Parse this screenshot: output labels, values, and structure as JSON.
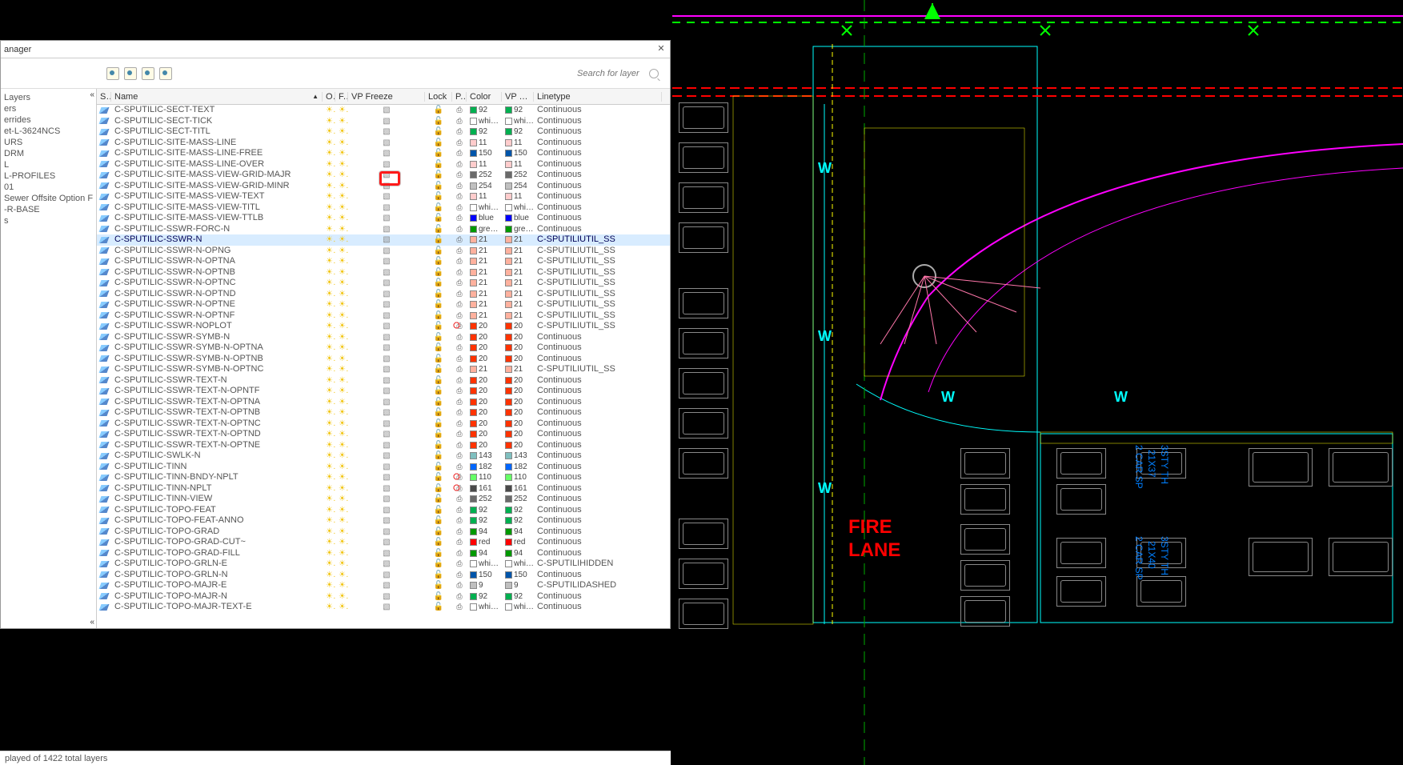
{
  "panel": {
    "title_fragment": "anager",
    "search_placeholder": "Search for layer"
  },
  "status": {
    "text": "played of 1422 total layers"
  },
  "cad": {
    "fire_lane": "FIRE\nLANE",
    "w_labels": [
      "W",
      "W",
      "W",
      "W",
      "W"
    ],
    "side1a": "3STY TH",
    "side1b": "21X37",
    "side1c": "2 CAR SP",
    "side2a": "3STY TH",
    "side2b": "21X40",
    "side2c": "2 CAR SP"
  },
  "sidebar_items": [
    "",
    "",
    "Layers",
    "ers",
    "errides",
    "",
    "et-L-3624NCS",
    "",
    "URS",
    "DRM",
    "L",
    "L-PROFILES",
    "01",
    "Sewer Offsite Option F",
    "-R-BASE",
    "s"
  ],
  "columns": {
    "s": "S..",
    "name": "Name",
    "o": "O..",
    "f": "F..",
    "vpf": "VP Freeze",
    "lock": "Lock",
    "p": "P..",
    "color": "Color",
    "vpc": "VP C..",
    "lt": "Linetype"
  },
  "palette": {
    "92": "#00b050",
    "whi": "#ffffff",
    "11": "#ffcccc",
    "150": "#0055aa",
    "252": "#6a6a6a",
    "254": "#c0c0c0",
    "blue": "#0000ff",
    "gre": "#009900",
    "21": "#ffb19e",
    "20": "#ff3300",
    "143": "#7fbfbf",
    "182": "#0066ff",
    "110": "#66ff66",
    "161": "#4a4a4a",
    "94": "#009900",
    "red": "#ff0000",
    "9": "#bfbfbf"
  },
  "layers": [
    {
      "name": "C-SPUTILIC-SECT-TEXT",
      "color": "92",
      "lt": "Continuous"
    },
    {
      "name": "C-SPUTILIC-SECT-TICK",
      "color": "whi",
      "lt": "Continuous"
    },
    {
      "name": "C-SPUTILIC-SECT-TITL",
      "color": "92",
      "lt": "Continuous"
    },
    {
      "name": "C-SPUTILIC-SITE-MASS-LINE",
      "color": "11",
      "lt": "Continuous"
    },
    {
      "name": "C-SPUTILIC-SITE-MASS-LINE-FREE",
      "color": "150",
      "lt": "Continuous"
    },
    {
      "name": "C-SPUTILIC-SITE-MASS-LINE-OVER",
      "color": "11",
      "lt": "Continuous"
    },
    {
      "name": "C-SPUTILIC-SITE-MASS-VIEW-GRID-MAJR",
      "color": "252",
      "lt": "Continuous"
    },
    {
      "name": "C-SPUTILIC-SITE-MASS-VIEW-GRID-MINR",
      "color": "254",
      "lt": "Continuous"
    },
    {
      "name": "C-SPUTILIC-SITE-MASS-VIEW-TEXT",
      "color": "11",
      "lt": "Continuous"
    },
    {
      "name": "C-SPUTILIC-SITE-MASS-VIEW-TITL",
      "color": "whi",
      "lt": "Continuous"
    },
    {
      "name": "C-SPUTILIC-SITE-MASS-VIEW-TTLB",
      "color": "blue",
      "lt": "Continuous"
    },
    {
      "name": "C-SPUTILIC-SSWR-FORC-N",
      "color": "gre",
      "lt": "Continuous"
    },
    {
      "name": "C-SPUTILIC-SSWR-N",
      "color": "21",
      "lt": "C-SPUTILIUTIL_SS",
      "sel": true
    },
    {
      "name": "C-SPUTILIC-SSWR-N-OPNG",
      "color": "21",
      "lt": "C-SPUTILIUTIL_SS"
    },
    {
      "name": "C-SPUTILIC-SSWR-N-OPTNA",
      "color": "21",
      "lt": "C-SPUTILIUTIL_SS"
    },
    {
      "name": "C-SPUTILIC-SSWR-N-OPTNB",
      "color": "21",
      "lt": "C-SPUTILIUTIL_SS"
    },
    {
      "name": "C-SPUTILIC-SSWR-N-OPTNC",
      "color": "21",
      "lt": "C-SPUTILIUTIL_SS"
    },
    {
      "name": "C-SPUTILIC-SSWR-N-OPTND",
      "color": "21",
      "lt": "C-SPUTILIUTIL_SS"
    },
    {
      "name": "C-SPUTILIC-SSWR-N-OPTNE",
      "color": "21",
      "lt": "C-SPUTILIUTIL_SS"
    },
    {
      "name": "C-SPUTILIC-SSWR-N-OPTNF",
      "color": "21",
      "lt": "C-SPUTILIUTIL_SS"
    },
    {
      "name": "C-SPUTILIC-SSWR-NOPLOT",
      "color": "20",
      "lt": "C-SPUTILIUTIL_SS",
      "noplot": true
    },
    {
      "name": "C-SPUTILIC-SSWR-SYMB-N",
      "color": "20",
      "lt": "Continuous"
    },
    {
      "name": "C-SPUTILIC-SSWR-SYMB-N-OPTNA",
      "color": "20",
      "lt": "Continuous"
    },
    {
      "name": "C-SPUTILIC-SSWR-SYMB-N-OPTNB",
      "color": "20",
      "lt": "Continuous"
    },
    {
      "name": "C-SPUTILIC-SSWR-SYMB-N-OPTNC",
      "color": "21",
      "lt": "C-SPUTILIUTIL_SS"
    },
    {
      "name": "C-SPUTILIC-SSWR-TEXT-N",
      "color": "20",
      "lt": "Continuous"
    },
    {
      "name": "C-SPUTILIC-SSWR-TEXT-N-OPNTF",
      "color": "20",
      "lt": "Continuous"
    },
    {
      "name": "C-SPUTILIC-SSWR-TEXT-N-OPTNA",
      "color": "20",
      "lt": "Continuous"
    },
    {
      "name": "C-SPUTILIC-SSWR-TEXT-N-OPTNB",
      "color": "20",
      "lt": "Continuous"
    },
    {
      "name": "C-SPUTILIC-SSWR-TEXT-N-OPTNC",
      "color": "20",
      "lt": "Continuous"
    },
    {
      "name": "C-SPUTILIC-SSWR-TEXT-N-OPTND",
      "color": "20",
      "lt": "Continuous"
    },
    {
      "name": "C-SPUTILIC-SSWR-TEXT-N-OPTNE",
      "color": "20",
      "lt": "Continuous"
    },
    {
      "name": "C-SPUTILIC-SWLK-N",
      "color": "143",
      "lt": "Continuous"
    },
    {
      "name": "C-SPUTILIC-TINN",
      "color": "182",
      "lt": "Continuous"
    },
    {
      "name": "C-SPUTILIC-TINN-BNDY-NPLT",
      "color": "110",
      "lt": "Continuous",
      "noplot": true
    },
    {
      "name": "C-SPUTILIC-TINN-NPLT",
      "color": "161",
      "lt": "Continuous",
      "noplot": true
    },
    {
      "name": "C-SPUTILIC-TINN-VIEW",
      "color": "252",
      "lt": "Continuous"
    },
    {
      "name": "C-SPUTILIC-TOPO-FEAT",
      "color": "92",
      "lt": "Continuous"
    },
    {
      "name": "C-SPUTILIC-TOPO-FEAT-ANNO",
      "color": "92",
      "lt": "Continuous"
    },
    {
      "name": "C-SPUTILIC-TOPO-GRAD",
      "color": "94",
      "lt": "Continuous"
    },
    {
      "name": "C-SPUTILIC-TOPO-GRAD-CUT~",
      "color": "red",
      "lt": "Continuous"
    },
    {
      "name": "C-SPUTILIC-TOPO-GRAD-FILL",
      "color": "94",
      "lt": "Continuous"
    },
    {
      "name": "C-SPUTILIC-TOPO-GRLN-E",
      "color": "whi",
      "lt": "C-SPUTILIHIDDEN"
    },
    {
      "name": "C-SPUTILIC-TOPO-GRLN-N",
      "color": "150",
      "lt": "Continuous"
    },
    {
      "name": "C-SPUTILIC-TOPO-MAJR-E",
      "color": "9",
      "lt": "C-SPUTILIDASHED"
    },
    {
      "name": "C-SPUTILIC-TOPO-MAJR-N",
      "color": "92",
      "lt": "Continuous"
    },
    {
      "name": "C-SPUTILIC-TOPO-MAJR-TEXT-E",
      "color": "whi",
      "lt": "Continuous"
    }
  ]
}
